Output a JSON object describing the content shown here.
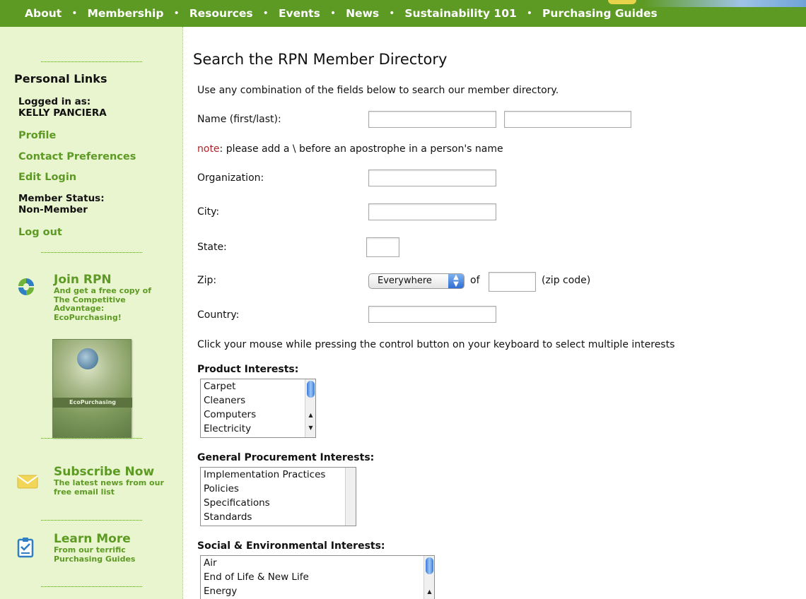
{
  "nav": {
    "items": [
      "About",
      "Membership",
      "Resources",
      "Events",
      "News",
      "Sustainability 101",
      "Purchasing Guides"
    ],
    "separator": "•",
    "color": "#5d9a23"
  },
  "sidebar": {
    "personal_title": "Personal Links",
    "logged_in_label": "Logged in as:",
    "user_name": "KELLY PANCIERA",
    "links": {
      "profile": "Profile",
      "contact_preferences": "Contact Preferences",
      "edit_login": "Edit Login",
      "log_out": "Log out"
    },
    "member_status_label": "Member Status:",
    "member_status_value": "Non-Member",
    "promos": {
      "join": {
        "title": "Join RPN",
        "subtitle": "And get a free copy of The Competitive Advantage: EcoPurchasing!",
        "book_band": "EcoPurchasing"
      },
      "subscribe": {
        "title": "Subscribe Now",
        "subtitle": "The latest news from our free email list"
      },
      "learn": {
        "title": "Learn More",
        "subtitle": "From our terrific Purchasing Guides"
      }
    }
  },
  "main": {
    "title": "Search the RPN Member Directory",
    "intro": "Use any combination of the fields below to search our member directory.",
    "name_label": "Name (first/last):",
    "note_word": "note",
    "note_text": ": please add a \\ before an apostrophe in a person's name",
    "organization_label": "Organization:",
    "city_label": "City:",
    "state_label": "State:",
    "zip_label": "Zip:",
    "zip_select_value": "Everywhere",
    "zip_of": "of",
    "zip_note": "(zip code)",
    "country_label": "Country:",
    "multi_select_hint": "Click your mouse while pressing the control button on your keyboard to select multiple interests",
    "product_interests": {
      "label": "Product Interests:",
      "options": [
        "Carpet",
        "Cleaners",
        "Computers",
        "Electricity"
      ]
    },
    "general_interests": {
      "label": "General Procurement Interests:",
      "options": [
        "Implementation Practices",
        "Policies",
        "Specifications",
        "Standards"
      ]
    },
    "social_interests": {
      "label": "Social & Environmental Interests:",
      "options": [
        "Air",
        "End of Life & New Life",
        "Energy"
      ]
    }
  }
}
